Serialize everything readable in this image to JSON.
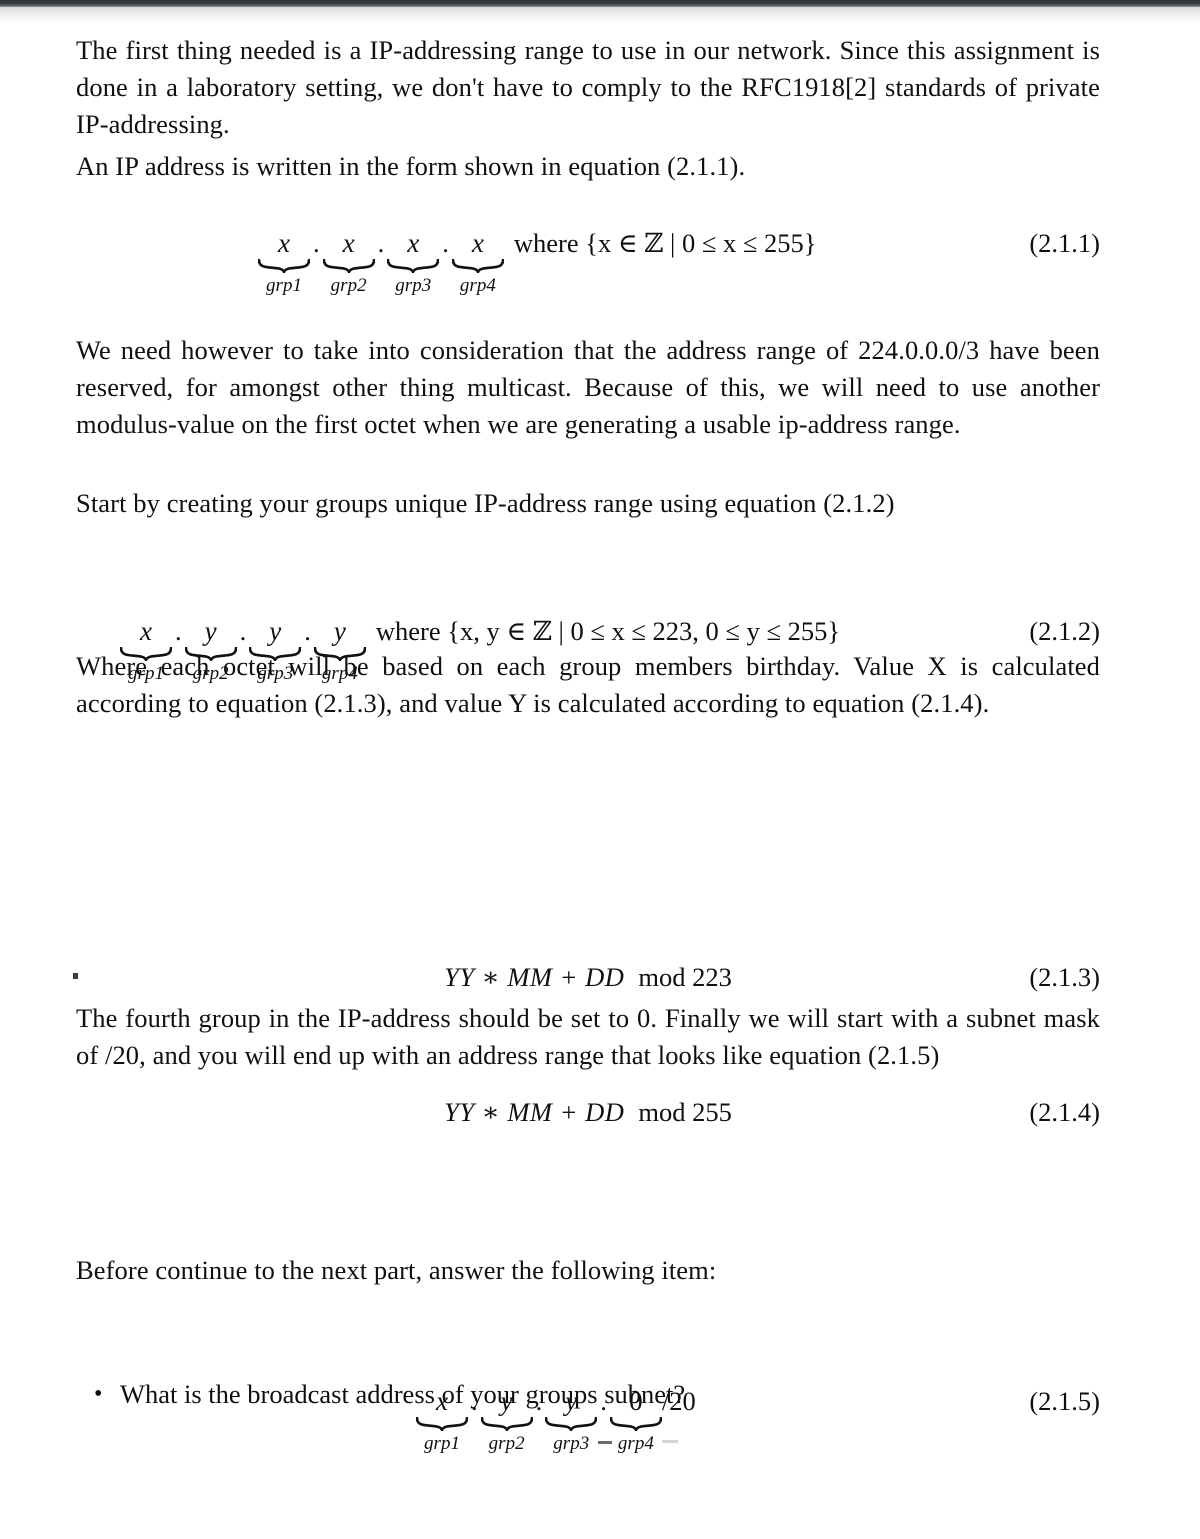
{
  "document": {
    "type": "scanned-academic-page",
    "paragraphs": {
      "p1": "The first thing needed is a IP-addressing range to use in our network. Since this assignment is done in a laboratory setting, we don't have to comply to the RFC1918[2] standards of private IP-addressing.",
      "p2": "An IP address is written in the form shown in equation (2.1.1).",
      "p3": "We need however to take into consideration that the address range of 224.0.0.0/3 have been reserved, for amongst other thing multicast. Because of this, we will need to use another modulus-value on the first octet when we are generating a usable ip-address range.",
      "p4": "Start by creating your groups unique IP-address range using equation (2.1.2)",
      "p5": "Where each octet will be based on each group members birthday. Value X is calculated according to equation (2.1.3), and value Y is calculated according to equation (2.1.4).",
      "p6": "The fourth group in the IP-address should be set to 0. Finally we will start with a subnet mask of /20, and you will end up with an address range that looks like equation (2.1.5)",
      "p7": "Before continue to the next part, answer the following item:"
    },
    "equations": {
      "eq211": {
        "number": "(2.1.1)",
        "octets": [
          {
            "value": "x",
            "label": "grp1"
          },
          {
            "value": "x",
            "label": "grp2"
          },
          {
            "value": "x",
            "label": "grp3"
          },
          {
            "value": "x",
            "label": "grp4"
          }
        ],
        "separator": ".",
        "where": "where {x ∈ ℤ | 0 ≤ x ≤ 255}"
      },
      "eq212": {
        "number": "(2.1.2)",
        "octets": [
          {
            "value": "x",
            "label": "grp1"
          },
          {
            "value": "y",
            "label": "grp2"
          },
          {
            "value": "y",
            "label": "grp3"
          },
          {
            "value": "y",
            "label": "grp4"
          }
        ],
        "separator": ".",
        "where": "where {x, y ∈ ℤ | 0 ≤ x ≤ 223, 0 ≤ y ≤ 255}"
      },
      "eq213": {
        "number": "(2.1.3)",
        "expression": "YY ∗ MM + DD",
        "modulus": "mod 223"
      },
      "eq214": {
        "number": "(2.1.4)",
        "expression": "YY ∗ MM + DD",
        "modulus": "mod 255"
      },
      "eq215": {
        "number": "(2.1.5)",
        "octets": [
          {
            "value": "x",
            "label": "grp1"
          },
          {
            "value": "y",
            "label": "grp2"
          },
          {
            "value": "y",
            "label": "grp3"
          },
          {
            "value": "0",
            "label": "grp4"
          }
        ],
        "separator": ".",
        "suffix": "/20"
      }
    },
    "question_list": {
      "bullet_glyph": "•",
      "items": [
        "What is the broadcast address of your groups subnet?"
      ]
    }
  }
}
